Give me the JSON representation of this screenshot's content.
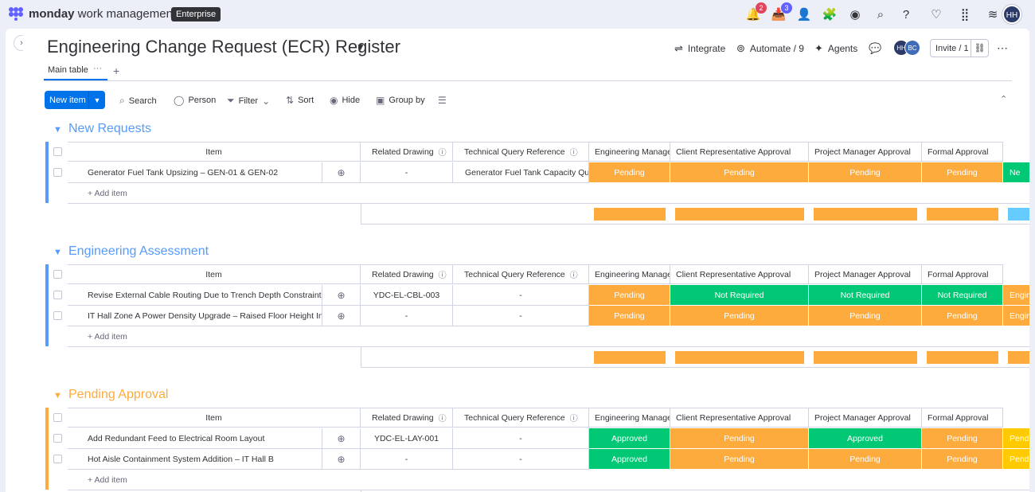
{
  "topbar": {
    "brand_bold": "monday",
    "brand_rest": " work management",
    "plan_badge": "Enterprise",
    "notifications_count": "2",
    "inbox_count": "3",
    "avatar_initials": "HH"
  },
  "board": {
    "title": "Engineering Change Request (ECR) Register",
    "integrate_label": "Integrate",
    "automate_label": "Automate / 9",
    "agents_label": "Agents",
    "invite_label": "Invite / 1",
    "members": [
      {
        "initials": "HH",
        "color": "#2b3a67"
      },
      {
        "initials": "BC",
        "color": "#3f6bb8"
      }
    ]
  },
  "tabs": {
    "main_table": "Main table"
  },
  "toolbar": {
    "new_item": "New item",
    "search": "Search",
    "person": "Person",
    "filter": "Filter",
    "sort": "Sort",
    "hide": "Hide",
    "group_by": "Group by"
  },
  "columns": {
    "item": "Item",
    "related_drawing": "Related Drawing",
    "technical_query": "Technical Query Reference",
    "engineering_manager": "Engineering Manager Approval",
    "client_rep": "Client Representative Approval",
    "project_manager": "Project Manager Approval",
    "formal": "Formal Approval"
  },
  "add_item_label": "+ Add item",
  "groups": [
    {
      "title": "New Requests",
      "color": "#579bfc",
      "rows": [
        {
          "item": "Generator Fuel Tank Upsizing – GEN-01 & GEN-02",
          "drawing": "-",
          "tq": "Generator Fuel Tank Capacity Query",
          "eng": "Pending",
          "client": "Pending",
          "pm": "Pending",
          "formal": "Pending",
          "extra": "Ne"
        }
      ]
    },
    {
      "title": "Engineering Assessment",
      "color": "#579bfc",
      "rows": [
        {
          "item": "Revise External Cable Routing Due to Trench Depth Constraint",
          "drawing": "YDC-EL-CBL-003",
          "tq": "-",
          "eng": "Pending",
          "client": "Not Required",
          "pm": "Not Required",
          "formal": "Not Required",
          "extra": "Engin"
        },
        {
          "item": "IT Hall Zone A Power Density Upgrade – Raised Floor Height Increase",
          "drawing": "-",
          "tq": "-",
          "eng": "Pending",
          "client": "Pending",
          "pm": "Pending",
          "formal": "Pending",
          "extra": "Engin"
        }
      ]
    },
    {
      "title": "Pending Approval",
      "color": "#fdab3d",
      "rows": [
        {
          "item": "Add Redundant Feed to Electrical Room Layout",
          "drawing": "YDC-EL-LAY-001",
          "tq": "-",
          "eng": "Approved",
          "client": "Pending",
          "pm": "Approved",
          "formal": "Pending",
          "extra": "Pendi"
        },
        {
          "item": "Hot Aisle Containment System Addition – IT Hall B",
          "drawing": "-",
          "tq": "-",
          "eng": "Approved",
          "client": "Pending",
          "pm": "Pending",
          "formal": "Pending",
          "extra": "Pendi"
        }
      ]
    }
  ],
  "colors": {
    "accent": "#0073ea",
    "pending": "#fdab3d",
    "done": "#00c875",
    "group_blue": "#579bfc",
    "group_orange": "#fdab3d"
  }
}
